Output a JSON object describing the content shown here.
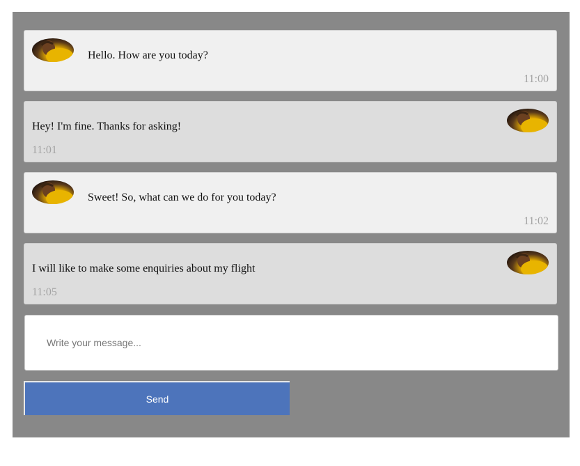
{
  "messages": [
    {
      "direction": "incoming",
      "text": "Hello. How are you today?",
      "time": "11:00"
    },
    {
      "direction": "outgoing",
      "text": "Hey! I'm fine. Thanks for asking!",
      "time": "11:01"
    },
    {
      "direction": "incoming",
      "text": "Sweet! So, what can we do for you today?",
      "time": "11:02"
    },
    {
      "direction": "outgoing",
      "text": "I will like to make some enquiries about my flight",
      "time": "11:05"
    }
  ],
  "composer": {
    "placeholder": "Write your message...",
    "value": ""
  },
  "send_button": {
    "label": "Send"
  },
  "colors": {
    "panel_background": "#888888",
    "incoming_bubble": "#f0f0f0",
    "outgoing_bubble": "#dddddd",
    "send_button": "#4d74bb",
    "timestamp": "#a3a3a3"
  },
  "icons": {
    "avatar": "user-avatar-photo"
  }
}
